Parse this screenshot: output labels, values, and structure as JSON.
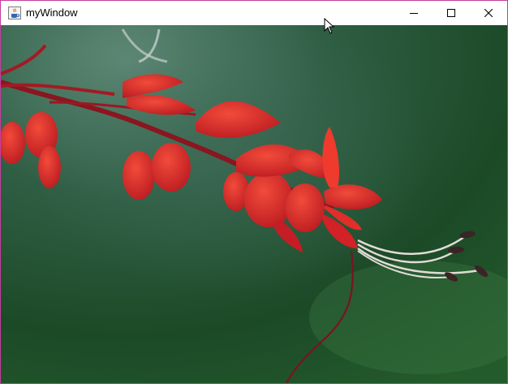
{
  "window": {
    "title": "myWindow",
    "border_color": "#c33d9d",
    "icons": {
      "app": "java-cup-icon",
      "minimize": "minimize-icon",
      "maximize": "maximize-icon",
      "close": "close-icon",
      "cursor": "mouse-pointer-icon"
    }
  },
  "content": {
    "image_subject": "red-flower-photo",
    "colors": {
      "background_dark": "#1f4a2c",
      "background_light": "#5f8a78",
      "flower": "#d8262c",
      "flower_light": "#f24b3a",
      "stem": "#7a1420"
    }
  }
}
